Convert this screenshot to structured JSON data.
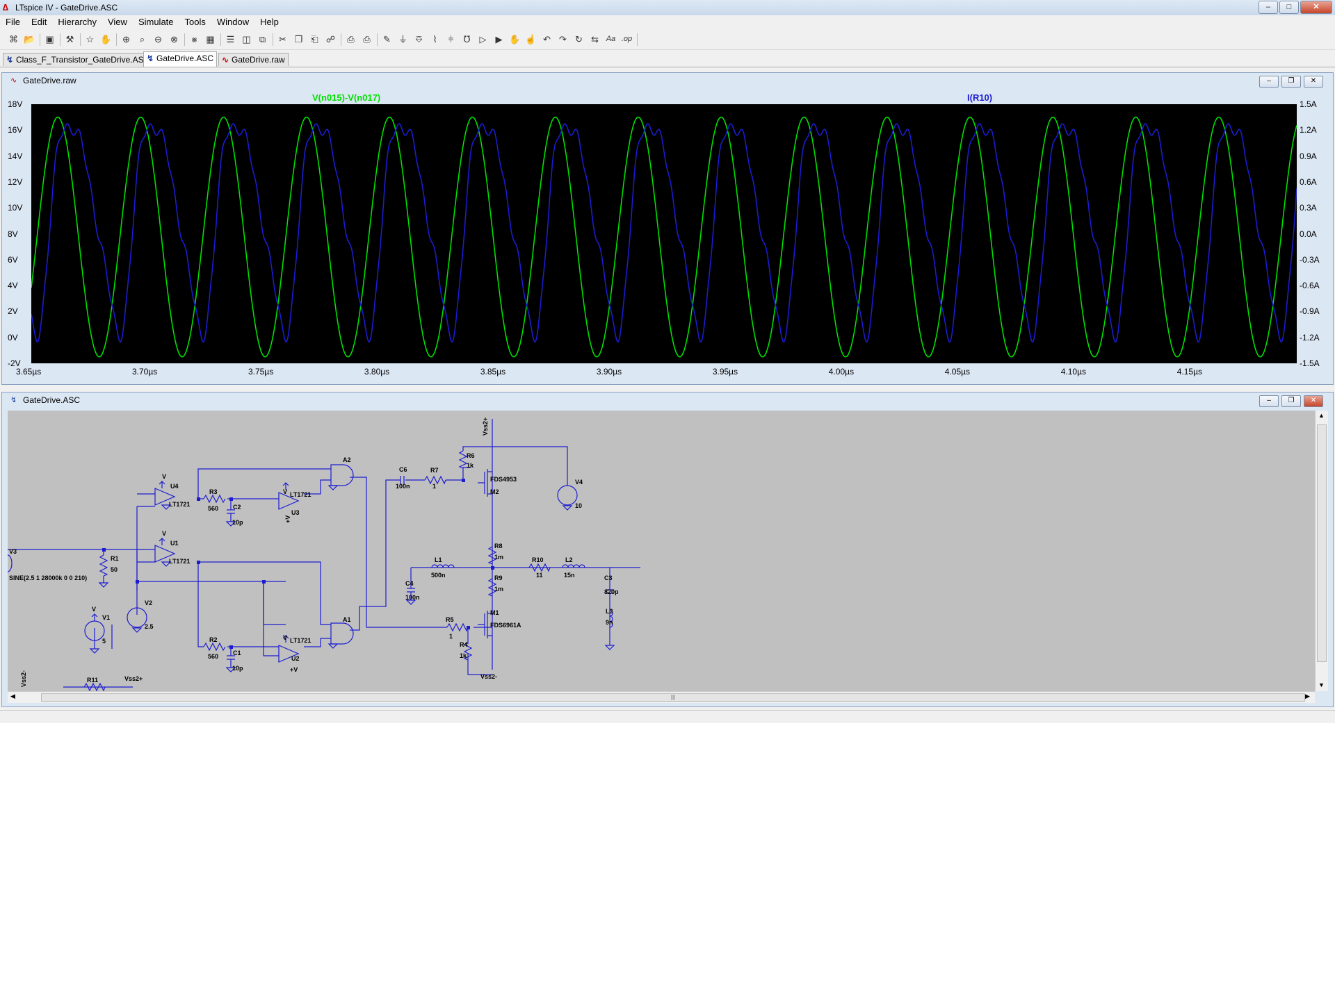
{
  "window": {
    "title": "LTspice IV - GateDrive.ASC",
    "controls": {
      "minimize": "–",
      "maximize": "□",
      "close": "✕"
    }
  },
  "menu": [
    "File",
    "Edit",
    "Hierarchy",
    "View",
    "Simulate",
    "Tools",
    "Window",
    "Help"
  ],
  "toolbar_icons": [
    "new-schematic-icon",
    "open-icon",
    "save-icon",
    "control-panel-icon",
    "run-icon",
    "halt-icon",
    "zoom-in-icon",
    "zoom-area-icon",
    "zoom-out-icon",
    "zoom-fit-icon",
    "autorange-icon",
    "grid-icon",
    "tile-horizontal-icon",
    "tile-vertical-icon",
    "cascade-icon",
    "cut-icon",
    "copy-icon",
    "paste-icon",
    "find-icon",
    "print-setup-icon",
    "print-icon",
    "wire-icon",
    "ground-icon",
    "label-net-icon",
    "resistor-icon",
    "capacitor-icon",
    "inductor-icon",
    "diode-icon",
    "component-icon",
    "move-icon",
    "drag-icon",
    "undo-icon",
    "redo-icon",
    "rotate-icon",
    "mirror-icon",
    "text-icon",
    "spice-directive-icon"
  ],
  "tabs": [
    {
      "label": "Class_F_Transistor_GateDrive.ASC",
      "type": "schematic",
      "active": false
    },
    {
      "label": "GateDrive.ASC",
      "type": "schematic",
      "active": true
    },
    {
      "label": "GateDrive.raw",
      "type": "waveform",
      "active": false
    }
  ],
  "waveform_window": {
    "title": "GateDrive.raw"
  },
  "schematic_window": {
    "title": "GateDrive.ASC"
  },
  "chart_data": {
    "type": "line",
    "x_ticks": [
      "3.65µs",
      "3.70µs",
      "3.75µs",
      "3.80µs",
      "3.85µs",
      "3.90µs",
      "3.95µs",
      "4.00µs",
      "4.05µs",
      "4.10µs",
      "4.15µs"
    ],
    "xlim_us": [
      3.65,
      4.195
    ],
    "y_left_ticks": [
      "18V",
      "16V",
      "14V",
      "12V",
      "10V",
      "8V",
      "6V",
      "4V",
      "2V",
      "0V",
      "-2V"
    ],
    "ylim_left": [
      -2,
      18
    ],
    "y_right_ticks": [
      "1.5A",
      "1.2A",
      "0.9A",
      "0.6A",
      "0.3A",
      "0.0A",
      "-0.3A",
      "-0.6A",
      "-0.9A",
      "-1.2A",
      "-1.5A"
    ],
    "ylim_right": [
      -1.5,
      1.5
    ],
    "series": [
      {
        "name": "V(n015)-V(n017)",
        "color": "#00e000",
        "axis": "left",
        "waveform": "sine",
        "frequency_mhz": 28,
        "offset": 7.75,
        "amplitude": 9.25,
        "phase_deg": -97
      },
      {
        "name": "I(R10)",
        "color": "#1c1cd0",
        "axis": "right",
        "waveform": "distorted-sine",
        "frequency_mhz": 28,
        "offset": 0.23,
        "amplitude": 1.28,
        "phase_deg": -165
      }
    ]
  },
  "schematic": {
    "components": [
      {
        "ref": "U4",
        "value": "LT1721"
      },
      {
        "ref": "U1",
        "value": "LT1721"
      },
      {
        "ref": "U3",
        "value": "LT1721"
      },
      {
        "ref": "U2",
        "value": "LT1721"
      },
      {
        "ref": "R3",
        "value": "560"
      },
      {
        "ref": "R2",
        "value": "560"
      },
      {
        "ref": "C2",
        "value": "10p"
      },
      {
        "ref": "C1",
        "value": "10p"
      },
      {
        "ref": "A2",
        "value": ""
      },
      {
        "ref": "A1",
        "value": ""
      },
      {
        "ref": "R1",
        "value": "50"
      },
      {
        "ref": "V3",
        "value": "SINE(2.5 1 28000k 0 0 210)"
      },
      {
        "ref": "V1",
        "value": "5"
      },
      {
        "ref": "V2",
        "value": "2.5"
      },
      {
        "ref": "C6",
        "value": "100n"
      },
      {
        "ref": "R7",
        "value": "1"
      },
      {
        "ref": "R6",
        "value": "1k"
      },
      {
        "ref": "M2",
        "value": "FDS4953"
      },
      {
        "ref": "V4",
        "value": "10"
      },
      {
        "ref": "R8",
        "value": "1m"
      },
      {
        "ref": "R9",
        "value": "1m"
      },
      {
        "ref": "L1",
        "value": "500n"
      },
      {
        "ref": "C4",
        "value": "100n"
      },
      {
        "ref": "R10",
        "value": "11"
      },
      {
        "ref": "L2",
        "value": "15n"
      },
      {
        "ref": "C3",
        "value": "820p"
      },
      {
        "ref": "L3",
        "value": "9n"
      },
      {
        "ref": "M1",
        "value": "FDS6961A"
      },
      {
        "ref": "R5",
        "value": "1"
      },
      {
        "ref": "R4",
        "value": "1k"
      },
      {
        "ref": "R11",
        "value": ""
      }
    ],
    "net_labels": {
      "vss2_plus": "Vss2+",
      "vss2_minus": "Vss2-",
      "vplus": "+V",
      "v": "V"
    },
    "scroll_grip": "|||"
  }
}
